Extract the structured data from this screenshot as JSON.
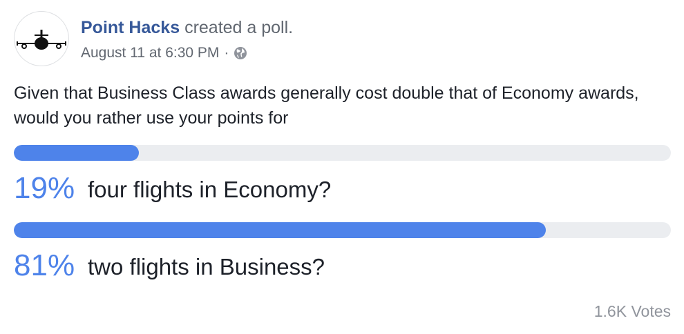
{
  "post": {
    "author": "Point Hacks",
    "action": "created a poll.",
    "timestamp": "August 11 at 6:30 PM",
    "separator": "·",
    "privacy_icon": "globe-icon",
    "avatar_icon": "airplane-icon"
  },
  "poll": {
    "question": "Given that Business Class awards generally cost double that of Economy awards, would you rather use your points for",
    "options": [
      {
        "percent_label": "19%",
        "percent": 19,
        "label": "four flights in Economy?"
      },
      {
        "percent_label": "81%",
        "percent": 81,
        "label": "two flights in Business?"
      }
    ],
    "votes": "1.6K Votes"
  },
  "colors": {
    "accent": "#4e83ea",
    "track": "#ebedf0",
    "author_link": "#365899",
    "secondary_text": "#616770",
    "muted_text": "#90949c"
  }
}
